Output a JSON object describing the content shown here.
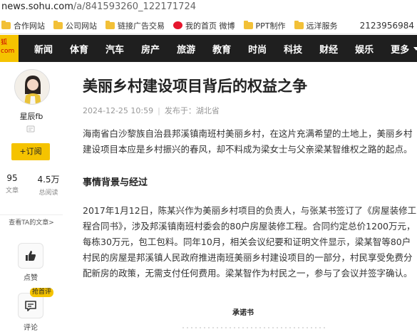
{
  "browser": {
    "url_host": "news.sohu.com",
    "url_path": "/a/841593260_122171724"
  },
  "bookmarks": [
    {
      "label": "合作网站",
      "icon": "folder-icon"
    },
    {
      "label": "公司网站",
      "icon": "folder-icon"
    },
    {
      "label": "链接广告交易",
      "icon": "folder-icon"
    },
    {
      "label": "我的首页 微博",
      "icon": "weibo-icon"
    },
    {
      "label": "PPT制作",
      "icon": "folder-icon"
    },
    {
      "label": "远洋服务",
      "icon": "folder-icon"
    }
  ],
  "bookmark_extra": "2123956984",
  "logo": {
    "line1": "狐",
    "line2": "com"
  },
  "nav": {
    "items": [
      "新闻",
      "体育",
      "汽车",
      "房产",
      "旅游",
      "教育",
      "时尚",
      "科技",
      "财经",
      "娱乐"
    ],
    "more": "更多"
  },
  "sidebar": {
    "author_name": "星辰fb",
    "follow_label": "+订阅",
    "articles_count": "95",
    "articles_label": "文章",
    "reads_count": "4.5万",
    "reads_label": "总阅读",
    "more_link": "查看TA的文章>",
    "like_label": "点赞",
    "comment_label": "评论",
    "comment_badge": "抢首评"
  },
  "article": {
    "title": "美丽乡村建设项目背后的权益之争",
    "date": "2024-12-25 10:59",
    "source": "发布于：湖北省",
    "intro": "海南省白沙黎族自治县邦溪镇南班村美丽乡村，在这片充满希望的土地上，美丽乡村建设项目本应是乡村振兴的春风，却不料成为梁女士与父亲梁某智维权之路的起点。",
    "section_heading": "事情背景与经过",
    "body": "2017年1月12日，陈某兴作为美丽乡村项目的负责人，与张某书签订了《房屋装修工程合同书》，涉及邦溪镇南班村委会的80户房屋装修工程。合同约定总价1200万元，每栋30万元，包工包料。同年10月，相关会议纪要和证明文件显示，梁某智等80户村民的房屋是邦溪镇人民政府推进南班美丽乡村建设项目的一部分，村民享受免费分配新房的政策，无需支付任何费用。梁某智作为村民之一，参与了会议并签字确认。",
    "pledge_heading": "承诺书"
  },
  "colors": {
    "navbar_bg": "#1f1f1f",
    "accent_yellow": "#f5c300"
  }
}
